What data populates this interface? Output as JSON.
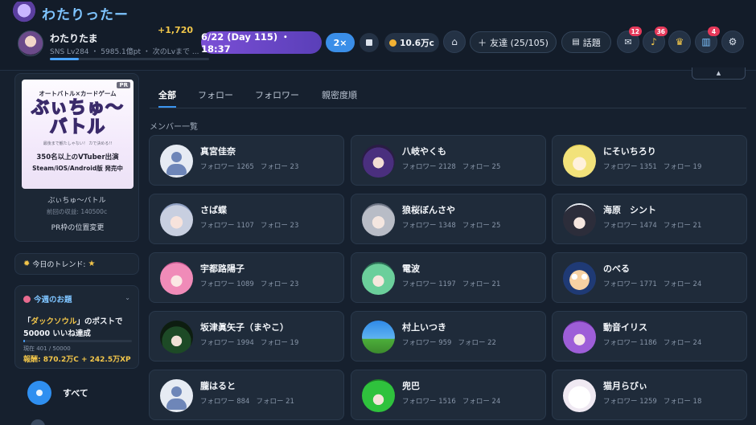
{
  "app": {
    "title": "わたりったー"
  },
  "user": {
    "name": "わたりたま",
    "points_delta": "+1,720",
    "level_line": "SNS Lv284 ・ 5985.1億pt ・ 次のLvまで ...",
    "xp_progress": 0.18
  },
  "toolbar": {
    "date": "6/22 (Day 115) ・ 18:37",
    "speed": "2×",
    "money": "10.6万c",
    "friends": "友達 (25/105)",
    "topics": "話題",
    "mail_badge": "12",
    "bell_badge": "36",
    "book_badge": "4"
  },
  "sidebar": {
    "pr": {
      "tag": "PR",
      "banner_sub": "オートバトル×カードゲーム",
      "banner_title": "ぶぃちゅ〜\nバトル",
      "banner_small": "最後まで観たしゃない！ カで決める!!",
      "banner_line1": "350名以上のVTuber出演",
      "banner_line2": "Steam/iOS/Android版 発売中",
      "name": "ぶぃちゅ〜バトル",
      "income": "前回の収益: 140500c",
      "position_button": "PR枠の位置変更"
    },
    "trend": {
      "label": "今日のトレンド:",
      "icon": "star"
    },
    "weekly": {
      "title": "今週のお題",
      "line1_pre": "「",
      "line1_hl": "ダックソウル",
      "line1_post": "」のポストで",
      "line2": "50000 いいね達成",
      "progress_text": "現在 401 / 50000",
      "progress": 0.008,
      "reward": "報酬: 870.2万C + 242.5万XP"
    },
    "all_label": "すべて"
  },
  "tabs": [
    "全部",
    "フォロー",
    "フォロワー",
    "親密度順"
  ],
  "section_label": "メンバー一覧",
  "members": [
    {
      "name": "真宮佳奈",
      "followers": "フォロワー 1265",
      "following": "フォロー 23",
      "avatar": "default"
    },
    {
      "name": "八岐やくも",
      "followers": "フォロワー 2128",
      "following": "フォロー 25",
      "avatar": "purple-horns"
    },
    {
      "name": "にそいちろり",
      "followers": "フォロワー 1351",
      "following": "フォロー 19",
      "avatar": "blonde"
    },
    {
      "name": "さば蝶",
      "followers": "フォロワー 1107",
      "following": "フォロー 23",
      "avatar": "silver-hair"
    },
    {
      "name": "狼桜ぼんさや",
      "followers": "フォロワー 1348",
      "following": "フォロー 25",
      "avatar": "gray-wolf"
    },
    {
      "name": "海原　シント",
      "followers": "フォロワー 1474",
      "following": "フォロー 21",
      "avatar": "dark-hair"
    },
    {
      "name": "宇都路陽子",
      "followers": "フォロワー 1089",
      "following": "フォロー 23",
      "avatar": "pink-hair"
    },
    {
      "name": "電波",
      "followers": "フォロワー 1197",
      "following": "フォロー 21",
      "avatar": "green-hair"
    },
    {
      "name": "のべる",
      "followers": "フォロワー 1771",
      "following": "フォロー 24",
      "avatar": "navy-face"
    },
    {
      "name": "坂津眞矢子（まやこ）",
      "followers": "フォロワー 1994",
      "following": "フォロー 19",
      "avatar": "green-hat"
    },
    {
      "name": "村上いつき",
      "followers": "フォロワー 959",
      "following": "フォロー 22",
      "avatar": "sky"
    },
    {
      "name": "動音イリス",
      "followers": "フォロワー 1186",
      "following": "フォロー 24",
      "avatar": "violet-hair"
    },
    {
      "name": "朧はると",
      "followers": "フォロワー 884",
      "following": "フォロー 21",
      "avatar": "default"
    },
    {
      "name": "兜巴",
      "followers": "フォロワー 1516",
      "following": "フォロー 24",
      "avatar": "green-spiky"
    },
    {
      "name": "猫月らびぃ",
      "followers": "フォロワー 1259",
      "following": "フォロー 18",
      "avatar": "white-cat"
    }
  ],
  "colors": {
    "accent": "#3a95f0",
    "date_pill": "#7b4fd6",
    "gold": "#f2c64a",
    "badge": "#e6395a"
  }
}
